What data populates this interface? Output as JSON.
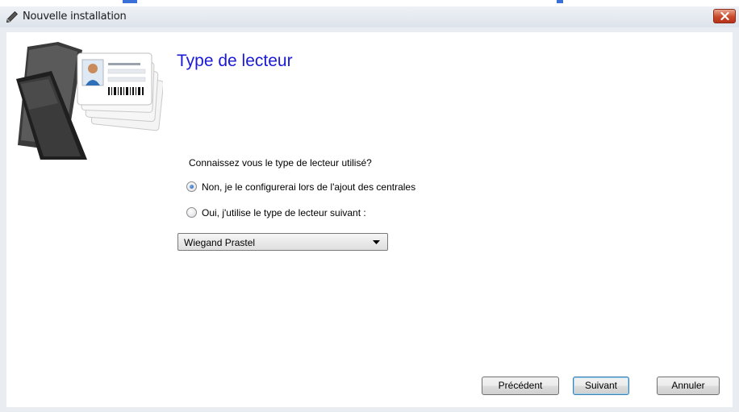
{
  "window": {
    "title": "Nouvelle installation",
    "title_icon": "pencil-icon",
    "close_icon": "close-icon"
  },
  "header": {
    "illustration": "id-cards-folder-illustration",
    "heading": "Type de lecteur"
  },
  "form": {
    "question": "Connaissez vous le type de lecteur utilisé?",
    "options": [
      {
        "label": "Non, je le configurerai lors de l'ajout des centrales",
        "selected": true
      },
      {
        "label": "Oui, j'utilise le type de lecteur suivant :",
        "selected": false
      }
    ],
    "reader_type": {
      "value": "Wiegand Prastel"
    }
  },
  "buttons": {
    "previous": "Précédent",
    "next": "Suivant",
    "cancel": "Annuler"
  },
  "colors": {
    "heading": "#1a1ad6",
    "close_button": "#c94a2b",
    "client_background": "#ffffff",
    "frame": "#e9ecf0"
  }
}
